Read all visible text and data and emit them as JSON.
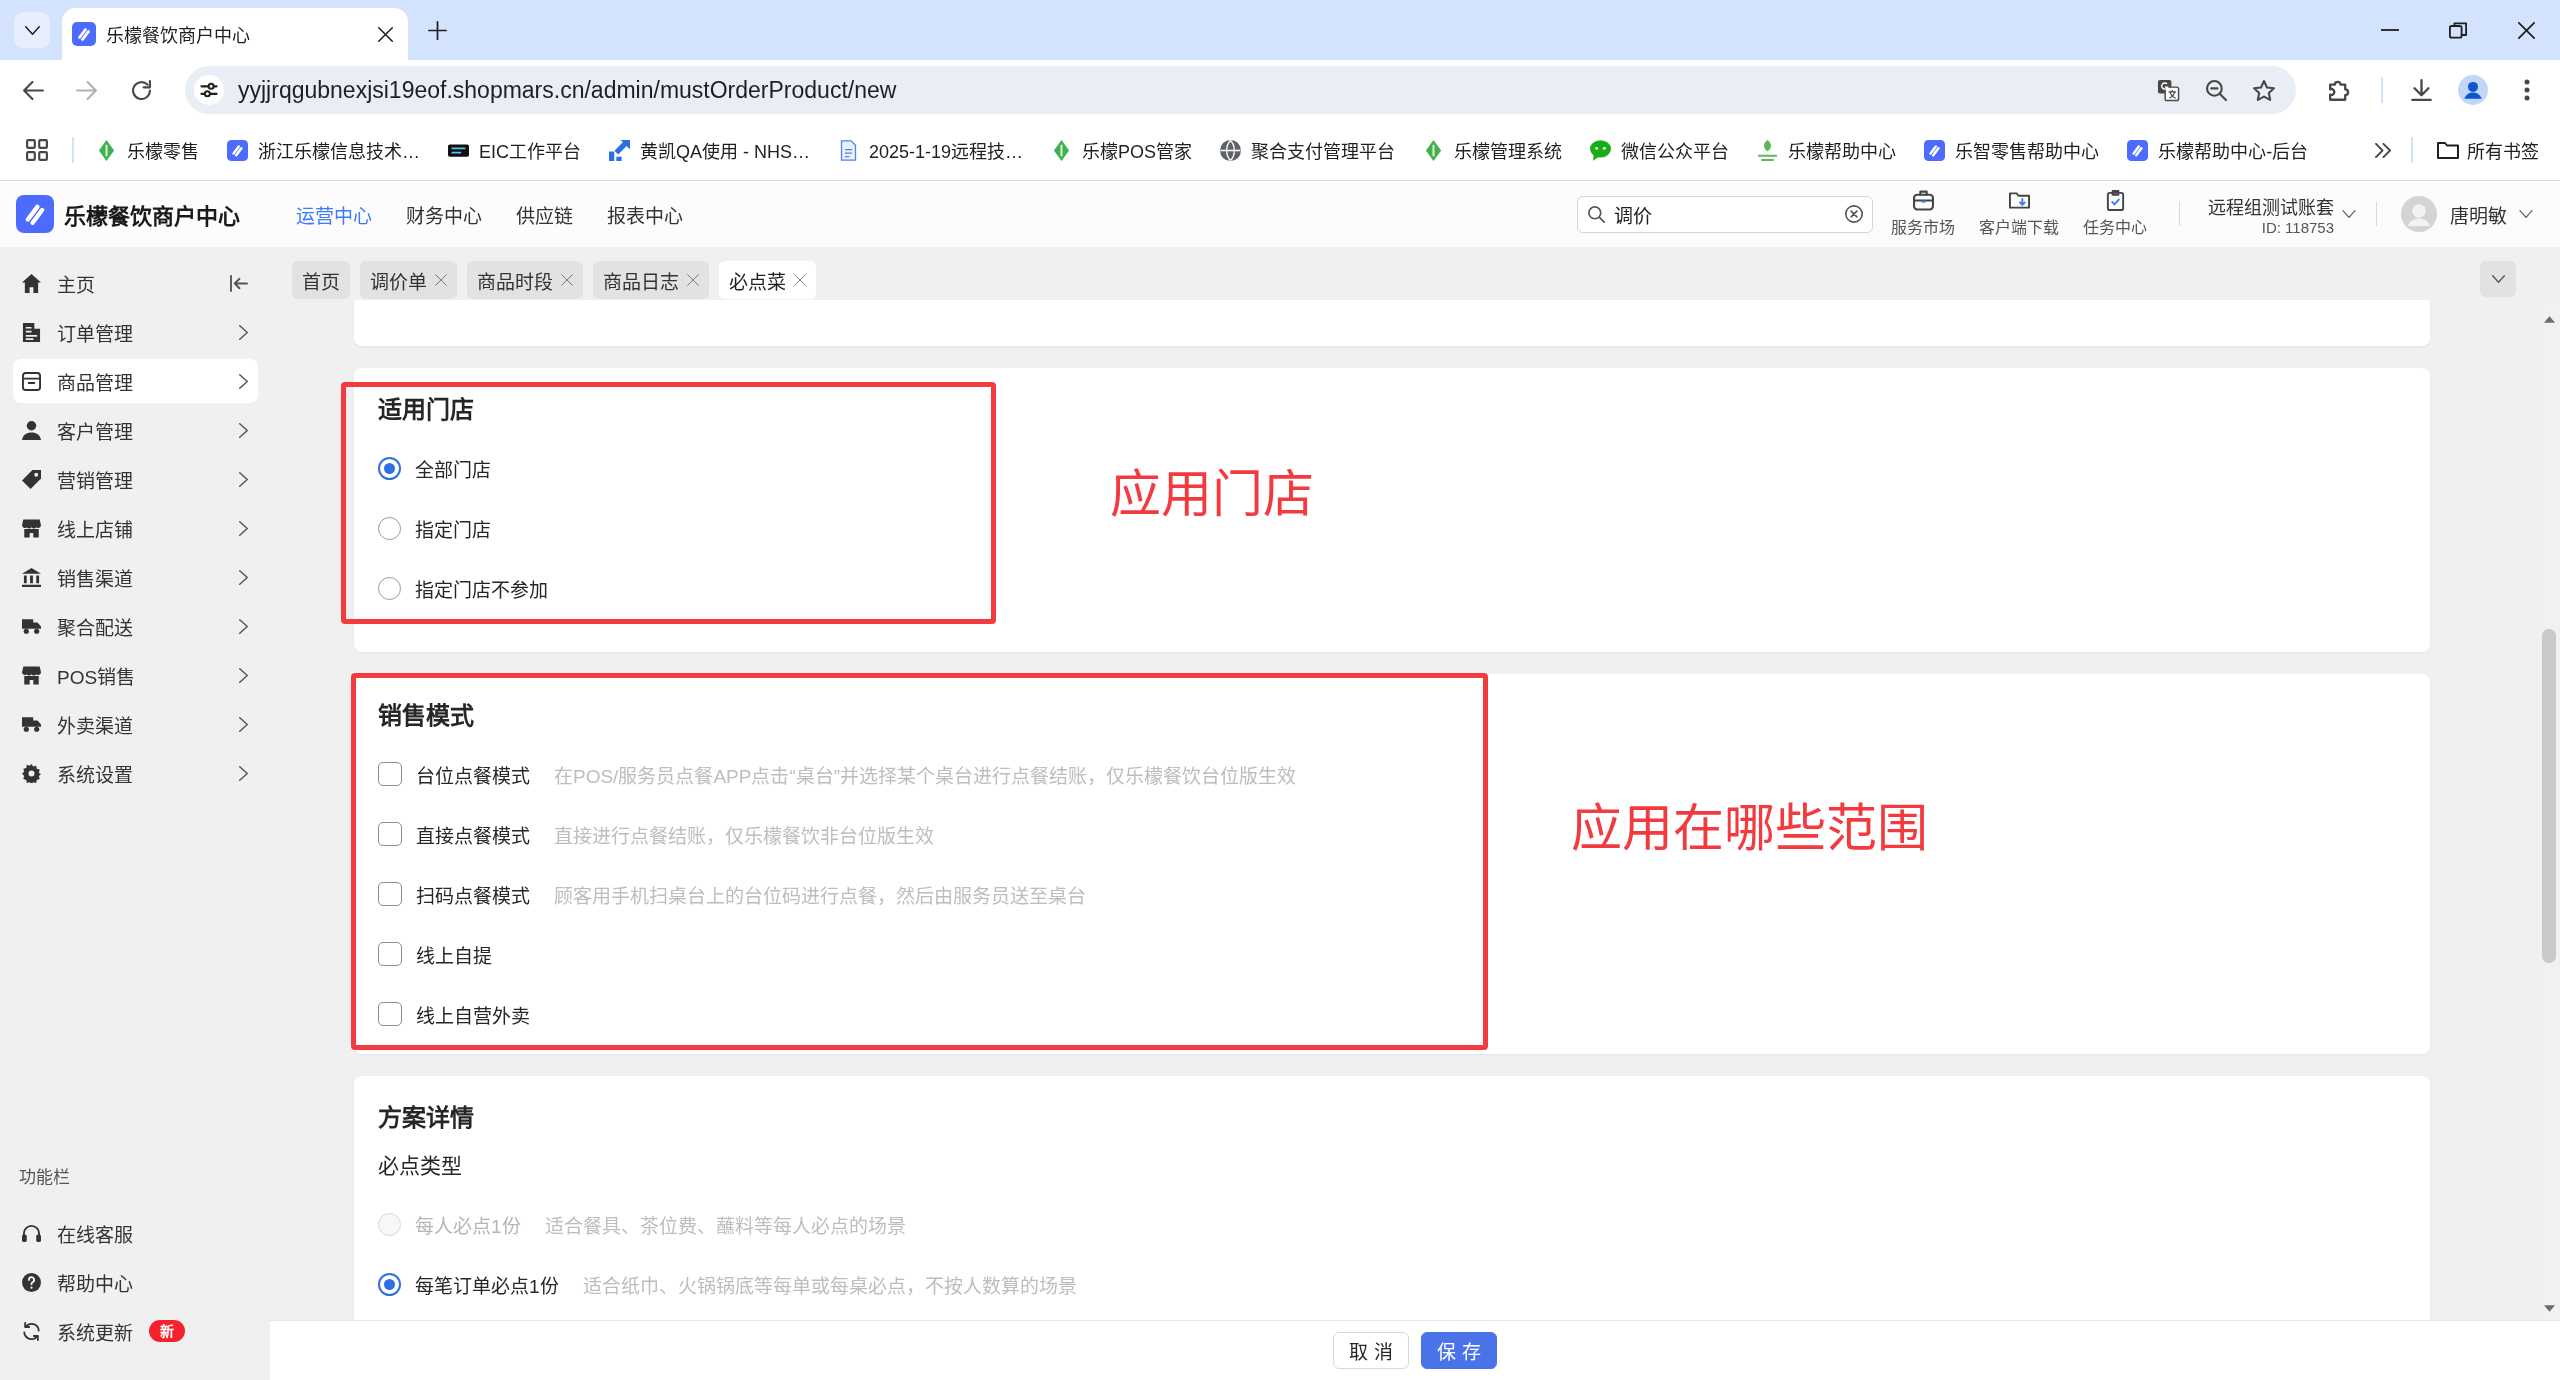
{
  "browser": {
    "tab_title": "乐檬餐饮商户中心",
    "url": "yyjjrqgubnexjsi19eof.shopmars.cn/admin/mustOrderProduct/new",
    "bookmarks": [
      {
        "label": "乐檬零售"
      },
      {
        "label": "浙江乐檬信息技术…"
      },
      {
        "label": "EIC工作平台"
      },
      {
        "label": "黄凯QA使用 - NHS…"
      },
      {
        "label": "2025-1-19远程技…"
      },
      {
        "label": "乐檬POS管家"
      },
      {
        "label": "聚合支付管理平台"
      },
      {
        "label": "乐檬管理系统"
      },
      {
        "label": "微信公众平台"
      },
      {
        "label": "乐檬帮助中心"
      },
      {
        "label": "乐智零售帮助中心"
      },
      {
        "label": "乐檬帮助中心-后台"
      }
    ],
    "all_bookmarks": "所有书签"
  },
  "header": {
    "title": "乐檬餐饮商户中心",
    "nav": [
      {
        "label": "运营中心",
        "selected": true
      },
      {
        "label": "财务中心",
        "selected": false
      },
      {
        "label": "供应链",
        "selected": false
      },
      {
        "label": "报表中心",
        "selected": false
      }
    ],
    "search": {
      "value": "调价"
    },
    "shortcuts": [
      {
        "label": "服务市场"
      },
      {
        "label": "客户端下载"
      },
      {
        "label": "任务中心"
      }
    ],
    "account": {
      "name": "远程组测试账套",
      "id": "ID: 118753"
    },
    "user": {
      "name": "唐明敏"
    }
  },
  "sidebar": {
    "items": [
      {
        "label": "主页",
        "selected": false,
        "has_children": false
      },
      {
        "label": "订单管理",
        "selected": false,
        "has_children": true
      },
      {
        "label": "商品管理",
        "selected": true,
        "has_children": true
      },
      {
        "label": "客户管理",
        "selected": false,
        "has_children": true
      },
      {
        "label": "营销管理",
        "selected": false,
        "has_children": true
      },
      {
        "label": "线上店铺",
        "selected": false,
        "has_children": true
      },
      {
        "label": "销售渠道",
        "selected": false,
        "has_children": true
      },
      {
        "label": "聚合配送",
        "selected": false,
        "has_children": true
      },
      {
        "label": "POS销售",
        "selected": false,
        "has_children": true
      },
      {
        "label": "外卖渠道",
        "selected": false,
        "has_children": true
      },
      {
        "label": "系统设置",
        "selected": false,
        "has_children": true
      }
    ],
    "section_title": "功能栏",
    "tools": [
      {
        "label": "在线客服"
      },
      {
        "label": "帮助中心"
      },
      {
        "label": "系统更新",
        "badge": "新"
      }
    ]
  },
  "page_tabs": [
    {
      "label": "首页",
      "selected": false,
      "closable": false
    },
    {
      "label": "调价单",
      "selected": false,
      "closable": true
    },
    {
      "label": "商品时段",
      "selected": false,
      "closable": true
    },
    {
      "label": "商品日志",
      "selected": false,
      "closable": true
    },
    {
      "label": "必点菜",
      "selected": true,
      "closable": true
    }
  ],
  "form": {
    "sections": [
      {
        "title": "适用门店",
        "groups": [
          {
            "kind": "radio",
            "options": [
              {
                "label": "全部门店",
                "selected": true
              },
              {
                "label": "指定门店",
                "selected": false
              },
              {
                "label": "指定门店不参加",
                "selected": false
              }
            ]
          }
        ]
      },
      {
        "title": "销售模式",
        "groups": [
          {
            "kind": "checkbox",
            "options": [
              {
                "label": "台位点餐模式",
                "checked": false,
                "description": "在POS/服务员点餐APP点击“桌台”并选择某个桌台进行点餐结账，仅乐檬餐饮台位版生效"
              },
              {
                "label": "直接点餐模式",
                "checked": false,
                "description": "直接进行点餐结账，仅乐檬餐饮非台位版生效"
              },
              {
                "label": "扫码点餐模式",
                "checked": false,
                "description": "顾客用手机扫桌台上的台位码进行点餐，然后由服务员送至桌台"
              },
              {
                "label": "线上自提",
                "checked": false
              },
              {
                "label": "线上自营外卖",
                "checked": false
              }
            ]
          }
        ]
      },
      {
        "title": "方案详情",
        "groups": [
          {
            "label": "必点类型",
            "kind": "radio",
            "options": [
              {
                "label": "每人必点1份",
                "selected": false,
                "disabled": true,
                "description": "适合餐具、茶位费、蘸料等每人必点的场景"
              },
              {
                "label": "每笔订单必点1份",
                "selected": true,
                "disabled": false,
                "description": "适合纸巾、火锅锅底等每单或每桌必点，不按人数算的场景"
              }
            ]
          }
        ]
      }
    ]
  },
  "annotations": [
    {
      "text": "应用门店"
    },
    {
      "text": "应用在哪些范围"
    }
  ],
  "actions": [
    {
      "label": "取消",
      "kind": "default"
    },
    {
      "label": "保存",
      "kind": "primary"
    }
  ]
}
